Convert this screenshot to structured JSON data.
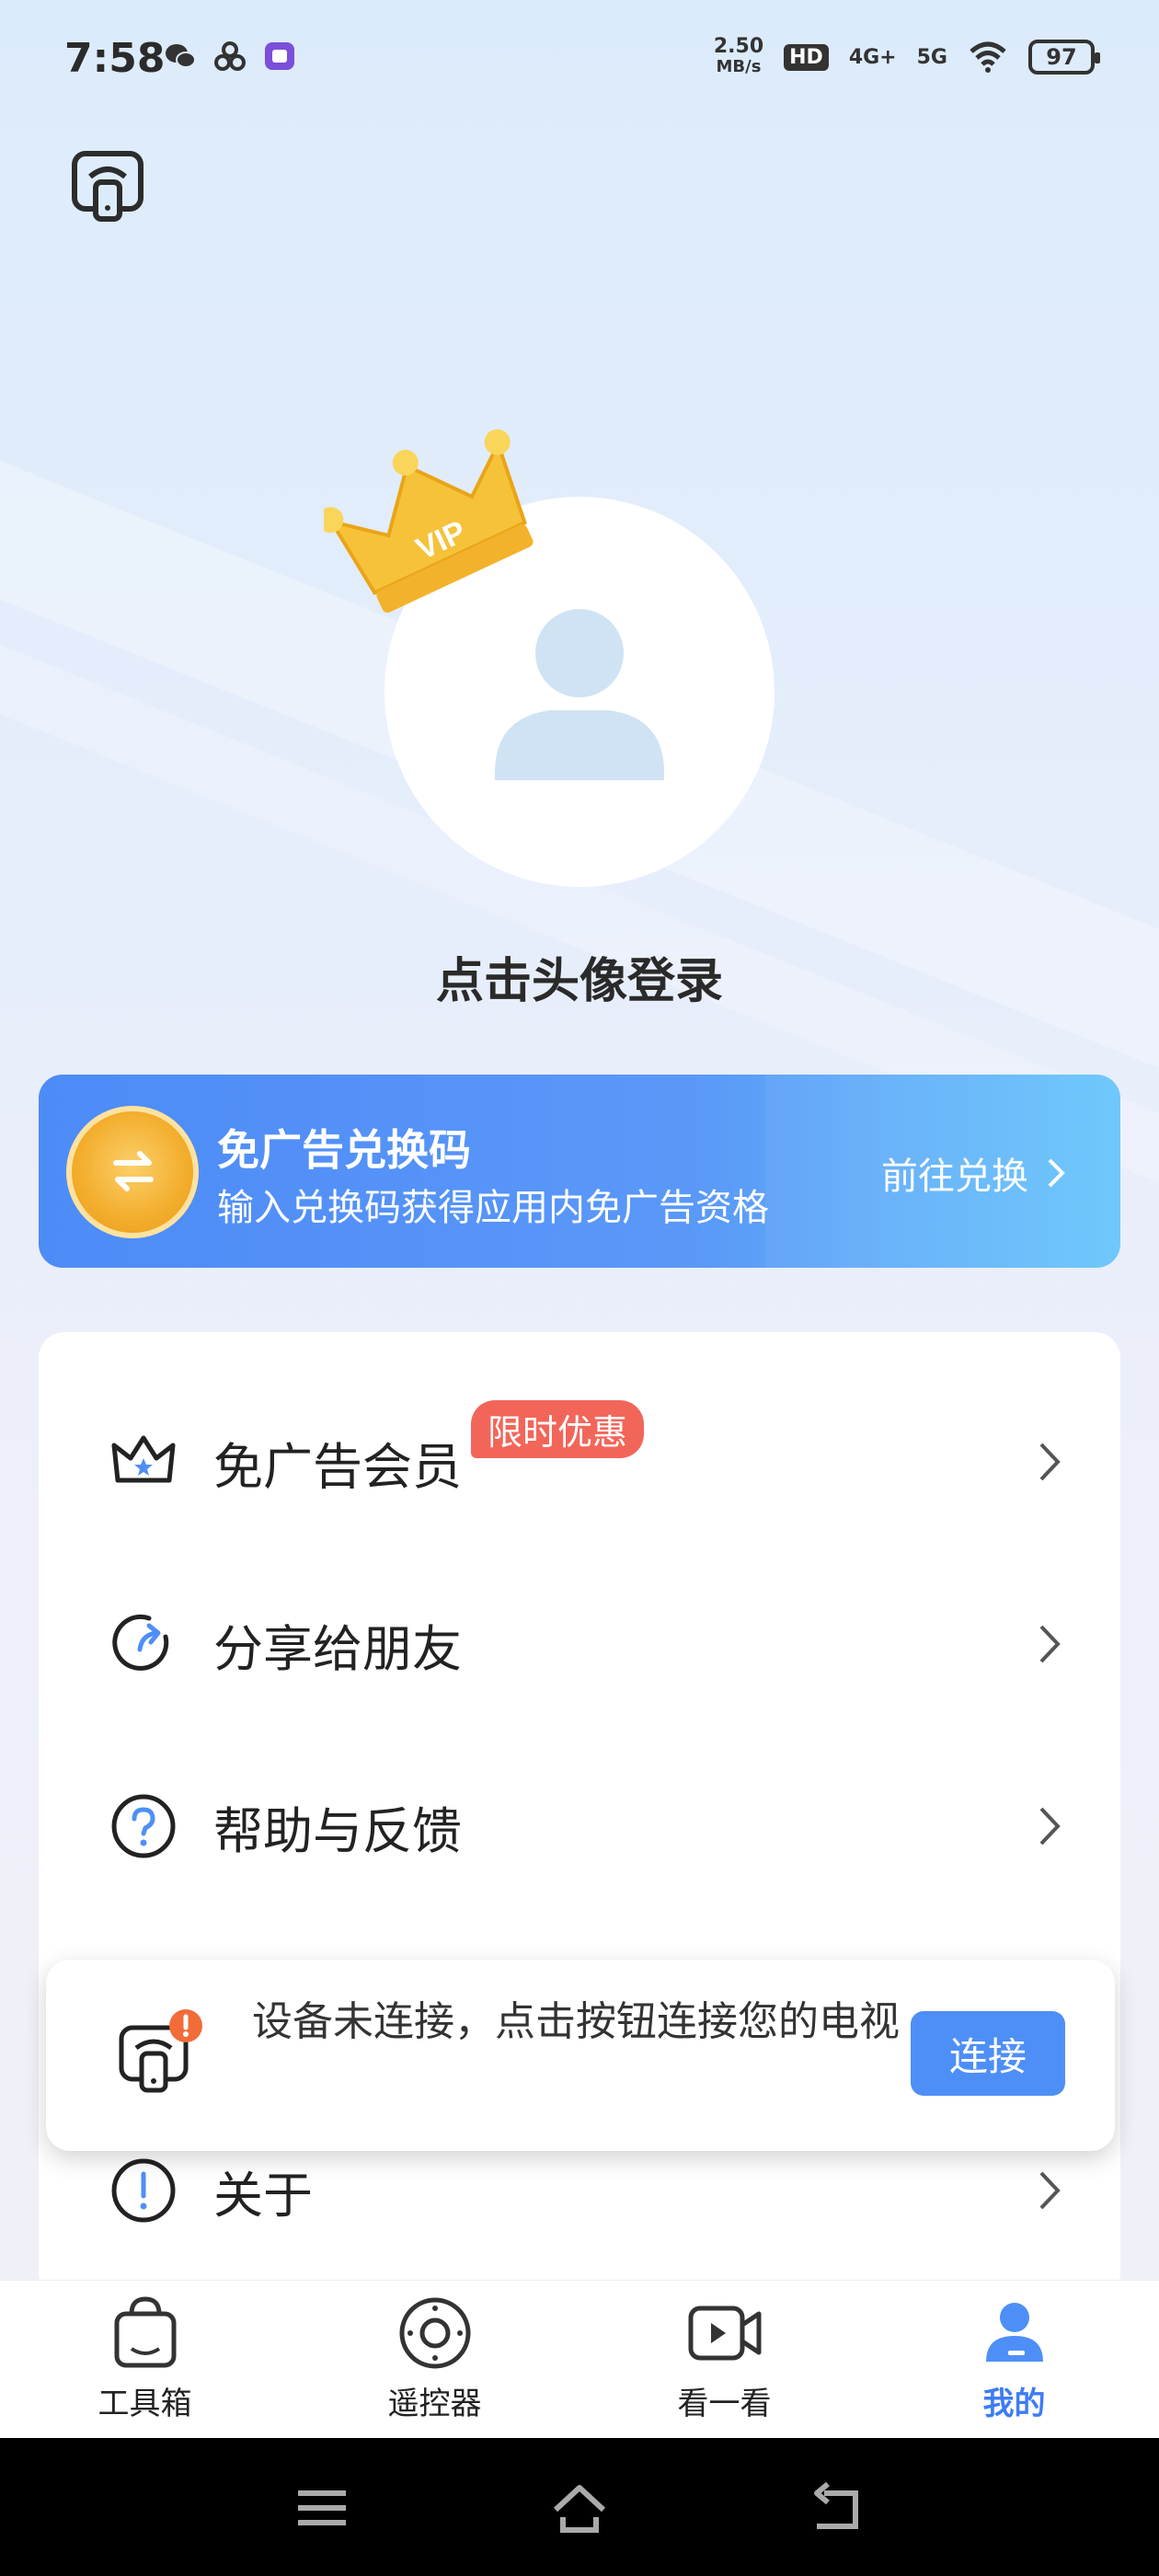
{
  "status_bar": {
    "time": "7:58",
    "speed_value": "2.50",
    "speed_unit": "MB/s",
    "hd_label": "HD",
    "network_4g": "4G+",
    "network_5g": "5G",
    "battery": "97"
  },
  "header": {
    "cast_icon": "tv-cast-icon"
  },
  "profile": {
    "crown_text": "VIP",
    "login_prompt": "点击头像登录"
  },
  "redeem_banner": {
    "title": "免广告兑换码",
    "subtitle": "输入兑换码获得应用内免广告资格",
    "action": "前往兑换"
  },
  "menu": {
    "items": [
      {
        "label": "免广告会员",
        "icon": "crown-icon",
        "badge": "限时优惠"
      },
      {
        "label": "分享给朋友",
        "icon": "share-icon"
      },
      {
        "label": "帮助与反馈",
        "icon": "help-icon"
      },
      {
        "label": "关于",
        "icon": "info-icon"
      }
    ]
  },
  "toast": {
    "message": "设备未连接，点击按钮连接您的电视",
    "button": "连接"
  },
  "bottom_nav": {
    "items": [
      {
        "label": "工具箱",
        "icon": "bag-icon"
      },
      {
        "label": "遥控器",
        "icon": "remote-dial-icon"
      },
      {
        "label": "看一看",
        "icon": "video-icon"
      },
      {
        "label": "我的",
        "icon": "person-icon",
        "active": true
      }
    ]
  },
  "colors": {
    "accent": "#4e8ff7",
    "active_nav": "#3e7cf4",
    "badge": "#f2665a",
    "coin": "#f3ad2c"
  }
}
